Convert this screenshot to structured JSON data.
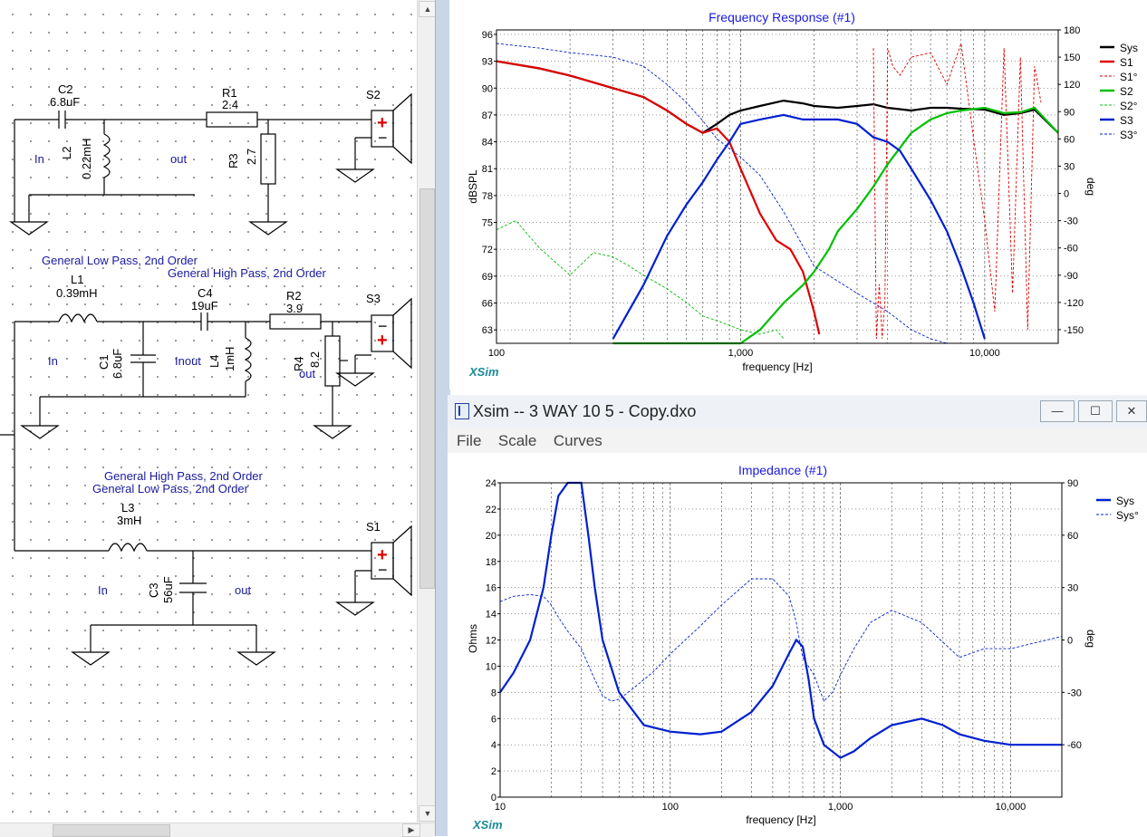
{
  "schematic": {
    "c2": {
      "name": "C2",
      "value": "6.8uF"
    },
    "r1": {
      "name": "R1",
      "value": "2.4"
    },
    "l2": {
      "name": "L2",
      "value": "0.22mH"
    },
    "r3": {
      "name": "R3",
      "value": "2.7"
    },
    "s2": "S2",
    "in1": "In",
    "out1": "out",
    "note_lp_2": "General Low Pass, 2nd Order",
    "note_hp_2": "General High Pass, 2nd Order",
    "l1": {
      "name": "L1",
      "value": "0.39mH"
    },
    "c4": {
      "name": "C4",
      "value": "19uF"
    },
    "r2": {
      "name": "R2",
      "value": "3.9"
    },
    "s3": "S3",
    "c1": {
      "name": "C1",
      "value": "6.8uF"
    },
    "l4": {
      "name": "L4",
      "value": "1mH"
    },
    "r4": {
      "name": "R4",
      "value": "8.2"
    },
    "in2": "In",
    "inout": "Inout",
    "out2": "out",
    "note_hp_1": "General High Pass, 2nd Order",
    "note_lp_1": "General Low Pass, 2nd Order",
    "l3": {
      "name": "L3",
      "value": "3mH"
    },
    "c3": {
      "name": "C3",
      "value": "56uF"
    },
    "s1": "S1",
    "in3": "In",
    "out3": "out",
    "plus": "+",
    "minus": "−"
  },
  "freq_response": {
    "title": "Frequency Response (#1)",
    "xlabel": "frequency [Hz]",
    "ylabel": "dBSPL",
    "ylabel_right": "deg",
    "brand": "XSim",
    "y_ticks": [
      "96",
      "93",
      "90",
      "87",
      "84",
      "81",
      "78",
      "75",
      "72",
      "69",
      "66",
      "63"
    ],
    "y2_ticks": [
      "180",
      "150",
      "120",
      "90",
      "60",
      "30",
      "0",
      "-30",
      "-60",
      "-90",
      "-120",
      "-150"
    ],
    "x_ticks": [
      "100",
      "1,000",
      "10,000"
    ],
    "legend": [
      {
        "label": "Sys",
        "color": "#000000",
        "dashed": false
      },
      {
        "label": "S1",
        "color": "#e00000",
        "dashed": false
      },
      {
        "label": "S1°",
        "color": "#e00000",
        "dashed": true
      },
      {
        "label": "S2",
        "color": "#00c000",
        "dashed": false
      },
      {
        "label": "S2°",
        "color": "#00c000",
        "dashed": true
      },
      {
        "label": "S3",
        "color": "#0020d0",
        "dashed": false
      },
      {
        "label": "S3°",
        "color": "#0020d0",
        "dashed": true
      }
    ]
  },
  "impedance_window": {
    "title": "Xsim -- 3 WAY 10 5 - Copy.dxo",
    "menu": [
      "File",
      "Scale",
      "Curves"
    ],
    "btn_min": "—",
    "btn_max": "☐",
    "btn_close": "✕"
  },
  "impedance": {
    "title": "Impedance (#1)",
    "xlabel": "frequency [Hz]",
    "ylabel": "Ohms",
    "ylabel_right": "deg",
    "brand": "XSim",
    "y_ticks": [
      "24",
      "22",
      "20",
      "18",
      "16",
      "14",
      "12",
      "10",
      "8",
      "6",
      "4",
      "2",
      "0"
    ],
    "y2_ticks": [
      "90",
      "60",
      "30",
      "0",
      "-30",
      "-60"
    ],
    "x_ticks": [
      "10",
      "100",
      "1,000",
      "10,000"
    ],
    "legend": [
      {
        "label": "Sys",
        "color": "#0020d0",
        "dashed": false
      },
      {
        "label": "Sys°",
        "color": "#0020d0",
        "dashed": true
      }
    ]
  },
  "chart_data": [
    {
      "type": "line",
      "title": "Frequency Response (#1)",
      "xlabel": "frequency [Hz]",
      "ylabel": "dBSPL",
      "y2label": "deg",
      "xscale": "log",
      "xlim": [
        100,
        20000
      ],
      "ylim": [
        61.5,
        96.5
      ],
      "y2lim": [
        -165,
        180
      ],
      "grid": true,
      "legend_position": "right",
      "series": [
        {
          "name": "Sys",
          "axis": "left",
          "x": [
            100,
            150,
            200,
            300,
            400,
            500,
            600,
            700,
            800,
            900,
            1000,
            1200,
            1500,
            1800,
            2000,
            2500,
            3000,
            3500,
            4000,
            5000,
            6000,
            7000,
            8000,
            10000,
            12000,
            14000,
            16000,
            20000
          ],
          "y": [
            93,
            92.2,
            91.4,
            90,
            89,
            87.5,
            86,
            85,
            86,
            87,
            87.5,
            88,
            88.6,
            88.3,
            88,
            87.8,
            88,
            88.2,
            87.8,
            87.5,
            87.8,
            87.8,
            87.7,
            87.6,
            87,
            87.2,
            87.6,
            85
          ]
        },
        {
          "name": "S1",
          "axis": "left",
          "x": [
            100,
            150,
            200,
            300,
            400,
            500,
            600,
            700,
            800,
            900,
            1000,
            1200,
            1400,
            1600,
            1800,
            2000,
            2100
          ],
          "y": [
            93,
            92.2,
            91.4,
            90,
            89,
            87.5,
            86,
            85,
            85.5,
            84,
            81,
            76,
            73,
            72,
            69.5,
            65,
            62.5
          ]
        },
        {
          "name": "S1°",
          "axis": "right",
          "x": [
            3500,
            3600,
            3700,
            3800,
            3900,
            4000,
            4200,
            4500,
            5000,
            6000,
            7000,
            8000,
            9000,
            10000,
            11000,
            12000,
            13000,
            14000,
            15000,
            16000,
            17000
          ],
          "y": [
            160,
            -160,
            -100,
            -160,
            -120,
            160,
            140,
            130,
            150,
            155,
            120,
            165,
            60,
            -30,
            -130,
            160,
            -110,
            150,
            -150,
            140,
            100
          ]
        },
        {
          "name": "S2",
          "axis": "left",
          "x": [
            300,
            700,
            1000,
            1200,
            1500,
            1800,
            2000,
            2300,
            2500,
            3000,
            3500,
            4000,
            5000,
            6000,
            7000,
            8000,
            10000,
            12000,
            14000,
            16000,
            20000
          ],
          "y": [
            58,
            59,
            60.5,
            63,
            66,
            68,
            69.5,
            72,
            74,
            76.5,
            79,
            81.5,
            85,
            86.5,
            87.2,
            87.5,
            87.8,
            87.2,
            87.3,
            87.8,
            85
          ]
        },
        {
          "name": "S2°",
          "axis": "right",
          "x": [
            100,
            120,
            150,
            200,
            250,
            300,
            350,
            400,
            500,
            600,
            700,
            800,
            1000,
            1200,
            1400,
            1500
          ],
          "y": [
            -40,
            -30,
            -60,
            -90,
            -65,
            -70,
            -80,
            -90,
            -105,
            -120,
            -135,
            -140,
            -150,
            -155,
            -150,
            -160
          ]
        },
        {
          "name": "S3",
          "axis": "left",
          "x": [
            300,
            400,
            500,
            600,
            700,
            800,
            900,
            1000,
            1200,
            1500,
            1800,
            2000,
            2500,
            3000,
            3500,
            4000,
            4500,
            5000,
            6000,
            7000,
            8000,
            9000,
            10000
          ],
          "y": [
            62,
            68,
            73.5,
            77,
            79.5,
            82,
            84,
            86,
            86.5,
            87,
            86.5,
            86.5,
            86.5,
            86,
            84.5,
            84,
            83,
            81,
            77.5,
            74,
            70,
            66,
            62
          ]
        },
        {
          "name": "S3°",
          "axis": "right",
          "x": [
            100,
            150,
            200,
            300,
            400,
            500,
            600,
            700,
            800,
            1000,
            1200,
            1500,
            2000,
            3000,
            4000,
            5000,
            6000,
            7000,
            8000,
            10000,
            12000,
            15000,
            20000
          ],
          "y": [
            165,
            160,
            155,
            150,
            140,
            120,
            100,
            80,
            60,
            40,
            20,
            -20,
            -80,
            -110,
            -130,
            -150,
            -160,
            -165,
            -165,
            -170,
            -175,
            -175,
            -175
          ]
        }
      ]
    },
    {
      "type": "line",
      "title": "Impedance (#1)",
      "xlabel": "frequency [Hz]",
      "ylabel": "Ohms",
      "y2label": "deg",
      "xscale": "log",
      "xlim": [
        10,
        20000
      ],
      "ylim": [
        0,
        24
      ],
      "y2lim": [
        -90,
        90
      ],
      "grid": true,
      "legend_position": "right",
      "series": [
        {
          "name": "Sys",
          "axis": "left",
          "x": [
            10,
            12,
            15,
            18,
            20,
            22,
            25,
            28,
            30,
            33,
            36,
            40,
            50,
            70,
            100,
            150,
            200,
            300,
            400,
            500,
            550,
            600,
            650,
            700,
            800,
            1000,
            1200,
            1500,
            2000,
            3000,
            4000,
            5000,
            7000,
            10000,
            20000
          ],
          "y": [
            8,
            9.5,
            12,
            16,
            20,
            23,
            25,
            25,
            24,
            20,
            16,
            12,
            8,
            5.5,
            5,
            4.8,
            5,
            6.5,
            8.5,
            11,
            12,
            11.5,
            9,
            6,
            4,
            3,
            3.5,
            4.5,
            5.5,
            6,
            5.5,
            4.8,
            4.3,
            4,
            4
          ]
        },
        {
          "name": "Sys°",
          "axis": "right",
          "x": [
            10,
            12,
            15,
            18,
            20,
            22,
            25,
            30,
            35,
            40,
            45,
            50,
            60,
            80,
            100,
            150,
            200,
            300,
            400,
            500,
            550,
            600,
            700,
            800,
            900,
            1000,
            1200,
            1500,
            2000,
            3000,
            5000,
            7000,
            10000,
            20000
          ],
          "y": [
            22,
            25,
            26,
            25,
            20,
            13,
            5,
            -5,
            -20,
            -32,
            -35,
            -34,
            -28,
            -18,
            -8,
            8,
            20,
            35,
            35,
            25,
            10,
            -10,
            -20,
            -35,
            -30,
            -20,
            -5,
            10,
            17,
            10,
            -10,
            -5,
            -5,
            2
          ]
        }
      ]
    }
  ]
}
